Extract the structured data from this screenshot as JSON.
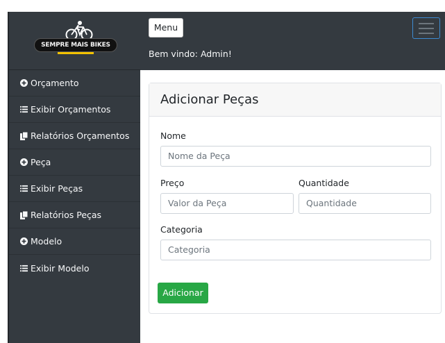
{
  "brand": {
    "logo_text": "SEMPRE MAIS BIKES"
  },
  "header": {
    "menu_label": "Menu",
    "welcome": "Bem vindo: Admin!"
  },
  "sidebar": {
    "items": [
      {
        "label": "Orçamento",
        "icon": "plus-circle-icon"
      },
      {
        "label": "Exibir Orçamentos",
        "icon": "list-icon"
      },
      {
        "label": "Relatórios Orçamentos",
        "icon": "copy-icon"
      },
      {
        "label": "Peça",
        "icon": "plus-circle-icon"
      },
      {
        "label": "Exibir Peças",
        "icon": "list-icon"
      },
      {
        "label": "Relatórios Peças",
        "icon": "copy-icon"
      },
      {
        "label": "Modelo",
        "icon": "plus-circle-icon"
      },
      {
        "label": "Exibir Modelo",
        "icon": "list-icon"
      }
    ]
  },
  "form": {
    "title": "Adicionar Peças",
    "nome": {
      "label": "Nome",
      "placeholder": "Nome da Peça"
    },
    "preco": {
      "label": "Preço",
      "placeholder": "Valor da Peça"
    },
    "quantidade": {
      "label": "Quantidade",
      "placeholder": "Quantidade"
    },
    "categoria": {
      "label": "Categoria",
      "placeholder": "Categoria"
    },
    "submit_label": "Adicionar"
  },
  "colors": {
    "sidebar": "#343a40",
    "accent_button": "#28a745",
    "toggler_border": "#3d8bd3"
  }
}
